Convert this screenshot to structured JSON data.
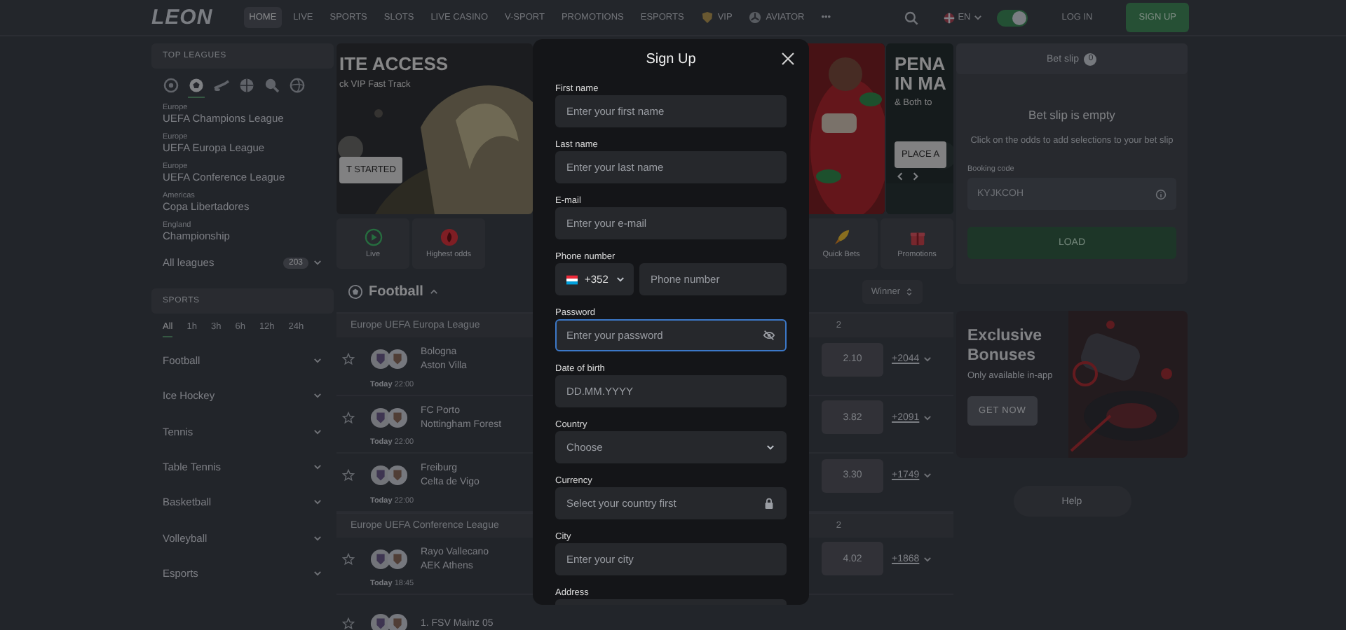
{
  "header": {
    "logo": "LEON",
    "nav": [
      {
        "label": "HOME",
        "kind": "plain",
        "selected": true
      },
      {
        "label": "LIVE",
        "kind": "plain",
        "selected": false
      },
      {
        "label": "SPORTS",
        "kind": "plain",
        "selected": false
      },
      {
        "label": "SLOTS",
        "kind": "plain",
        "selected": false
      },
      {
        "label": "LIVE CASINO",
        "kind": "plain",
        "selected": false
      },
      {
        "label": "V-SPORT",
        "kind": "plain",
        "selected": false
      },
      {
        "label": "PROMOTIONS",
        "kind": "plain",
        "selected": false
      },
      {
        "label": "ESPORTS",
        "kind": "plain",
        "selected": false
      },
      {
        "label": "VIP",
        "kind": "shield",
        "selected": false
      },
      {
        "label": "AVIATOR",
        "kind": "propeller",
        "selected": false
      },
      {
        "label": "•••",
        "kind": "plain",
        "selected": false
      }
    ],
    "language": "EN",
    "theme_toggle": {
      "on": true
    },
    "login": "LOG IN",
    "signup": "SIGN UP"
  },
  "sidebar": {
    "top_leagues": {
      "title": "TOP LEAGUES",
      "sport_filters": [
        {
          "kind": "ring",
          "selected": false
        },
        {
          "kind": "soccer",
          "selected": true
        },
        {
          "kind": "hockey",
          "selected": false
        },
        {
          "kind": "basketball",
          "selected": false
        },
        {
          "kind": "racket",
          "selected": false
        },
        {
          "kind": "volleyball",
          "selected": false
        }
      ],
      "leagues": [
        {
          "region": "Europe",
          "name": "UEFA Champions League"
        },
        {
          "region": "Europe",
          "name": "UEFA Europa League"
        },
        {
          "region": "Europe",
          "name": "UEFA Conference League"
        },
        {
          "region": "Americas",
          "name": "Copa Libertadores"
        },
        {
          "region": "England",
          "name": "Championship"
        }
      ],
      "all_leagues": {
        "label": "All leagues",
        "count": "203"
      }
    },
    "sports": {
      "title": "SPORTS",
      "time_filters": [
        {
          "label": "All",
          "selected": true
        },
        {
          "label": "1h",
          "selected": false
        },
        {
          "label": "3h",
          "selected": false
        },
        {
          "label": "6h",
          "selected": false
        },
        {
          "label": "12h",
          "selected": false
        },
        {
          "label": "24h",
          "selected": false
        }
      ],
      "items": [
        {
          "label": "Football",
          "expanded": false
        },
        {
          "label": "Ice Hockey",
          "expanded": false
        },
        {
          "label": "Tennis",
          "expanded": false
        },
        {
          "label": "Table Tennis",
          "expanded": false
        },
        {
          "label": "Basketball",
          "expanded": false
        },
        {
          "label": "Volleyball",
          "expanded": false
        },
        {
          "label": "Esports",
          "expanded": false
        }
      ]
    }
  },
  "main": {
    "banners": [
      {
        "kind": "picture",
        "title": [
          "ITE ACCESS"
        ],
        "subtitle": "ck VIP Fast Track",
        "button": "T STARTED"
      },
      {
        "kind": "picture"
      },
      {
        "kind": "picture",
        "title": [
          "PENA",
          "IN MA"
        ],
        "subtitle": "& Both to",
        "button": "PLACE A"
      }
    ],
    "quick_links": [
      {
        "label": "Live",
        "kind": "play"
      },
      {
        "label": "Highest odds",
        "kind": "flame"
      },
      {
        "label": "Quick Bets",
        "kind": "rocket"
      },
      {
        "label": "Promotions",
        "kind": "gift"
      }
    ],
    "football": {
      "title": "Football",
      "expanded": true,
      "market": "Winner",
      "leagues": [
        {
          "name": "Europe UEFA Europa League",
          "column": "2",
          "matches": [
            {
              "home": "Bologna",
              "away": "Aston Villa",
              "day": "Today",
              "time": "22:00",
              "odd": "2.10",
              "more": "+2044"
            },
            {
              "home": "FC Porto",
              "away": "Nottingham Forest",
              "day": "Today",
              "time": "22:00",
              "odd": "3.82",
              "more": "+2091"
            },
            {
              "home": "Freiburg",
              "away": "Celta de Vigo",
              "day": "Today",
              "time": "22:00",
              "odd": "3.30",
              "more": "+1749"
            }
          ]
        },
        {
          "name": "Europe UEFA Conference League",
          "column": "2",
          "matches": [
            {
              "home": "Rayo Vallecano",
              "away": "AEK Athens",
              "day": "Today",
              "time": "18:45",
              "odd": "4.02",
              "more": "+1868"
            },
            {
              "home": "1. FSV Mainz 05"
            }
          ]
        }
      ]
    }
  },
  "bet_slip": {
    "tab": "Bet slip",
    "count": "0",
    "empty_title": "Bet slip is empty",
    "empty_text": "Click on the odds to add selections to your bet slip",
    "booking_label": "Booking code",
    "booking_placeholder": "KYJKCOH",
    "load": "LOAD"
  },
  "promo": {
    "kind": "picture",
    "title": "Exclusive Bonuses",
    "subtitle": "Only available in-app",
    "button": "GET NOW"
  },
  "help": "Help",
  "modal": {
    "title": "Sign Up",
    "fields": [
      {
        "label": "First name",
        "kind": "text",
        "placeholder": "Enter your first name",
        "focused": false
      },
      {
        "label": "Last name",
        "kind": "text",
        "placeholder": "Enter your last name",
        "focused": false
      },
      {
        "label": "E-mail",
        "kind": "text",
        "placeholder": "Enter your e-mail",
        "focused": false
      },
      {
        "label": "Phone number",
        "kind": "phone",
        "country_code": "+352",
        "placeholder": "Phone number",
        "focused": false
      },
      {
        "label": "Password",
        "kind": "password",
        "placeholder": "Enter your password",
        "focused": true
      },
      {
        "label": "Date of birth",
        "kind": "text",
        "placeholder": "DD.MM.YYYY",
        "focused": false
      },
      {
        "label": "Country",
        "kind": "select",
        "placeholder": "Choose",
        "focused": false
      },
      {
        "label": "Currency",
        "kind": "locked",
        "placeholder": "Select your country first",
        "focused": false
      },
      {
        "label": "City",
        "kind": "text",
        "placeholder": "Enter your city",
        "focused": false
      },
      {
        "label": "Address",
        "kind": "text",
        "focused": false
      }
    ]
  }
}
